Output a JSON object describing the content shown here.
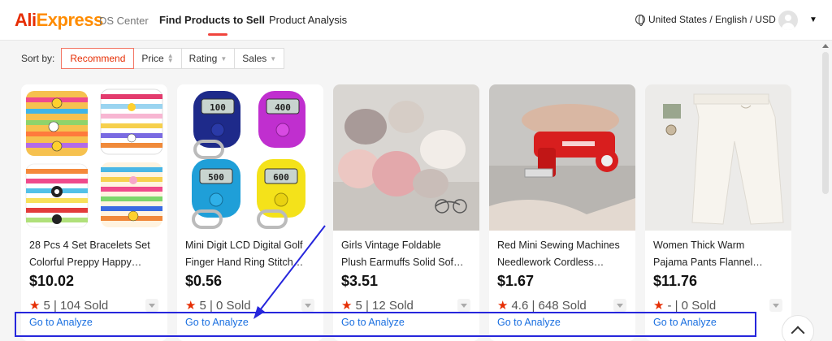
{
  "header": {
    "logo_part1": "Ali",
    "logo_part2": "Express",
    "subtitle": "DS Center",
    "tabs": [
      {
        "label": "Find Products to Sell",
        "active": true
      },
      {
        "label": "Product Analysis",
        "active": false
      }
    ],
    "locale": "United States / English / USD"
  },
  "sort": {
    "label": "Sort by:",
    "options": [
      {
        "label": "Recommend",
        "active": true
      },
      {
        "label": "Price"
      },
      {
        "label": "Rating"
      },
      {
        "label": "Sales"
      }
    ]
  },
  "products": [
    {
      "title_line1": "28 Pcs 4 Set Bracelets Set",
      "title_line2": "Colorful Preppy Happy…",
      "price": "$10.02",
      "stats": "5 | 104 Sold",
      "action": "Go to Analyze"
    },
    {
      "title_line1": "Mini Digit LCD Digital Golf",
      "title_line2": "Finger Hand Ring Stitch…",
      "price": "$0.56",
      "stats": "5 | 0 Sold",
      "action": "Go to Analyze"
    },
    {
      "title_line1": "Girls Vintage Foldable",
      "title_line2": "Plush Earmuffs Solid Sof…",
      "price": "$3.51",
      "stats": "5 | 12 Sold",
      "action": "Go to Analyze"
    },
    {
      "title_line1": "Red Mini Sewing Machines",
      "title_line2": "Needlework Cordless…",
      "price": "$1.67",
      "stats": "4.6 | 648 Sold",
      "action": "Go to Analyze"
    },
    {
      "title_line1": "Women Thick Warm",
      "title_line2": "Pajama Pants Flannel…",
      "price": "$11.76",
      "stats": "- | 0 Sold",
      "action": "Go to Analyze"
    }
  ],
  "counter_readouts": [
    "100",
    "400",
    "500",
    "600"
  ],
  "colors": {
    "brand_red": "#e62e04",
    "brand_orange": "#ff8c00",
    "link_blue": "#1a6fe0",
    "annotation_blue": "#2626dc"
  }
}
